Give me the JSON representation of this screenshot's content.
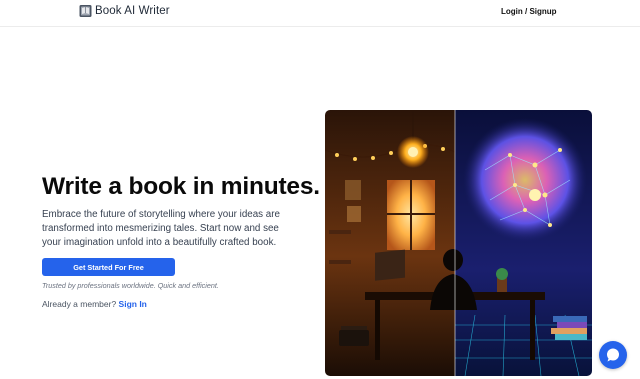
{
  "header": {
    "brand": "Book AI Writer",
    "login_label": "Login / Signup"
  },
  "hero": {
    "title": "Write a book in minutes.",
    "description": "Embrace the future of storytelling where your ideas are transformed into mesmerizing tales. Start now and see your imagination unfold into a beautifully crafted book.",
    "cta_label": "Get Started For Free",
    "trusted_text": "Trusted by professionals worldwide. Quick and efficient.",
    "member_prompt": "Already a member?",
    "signin_label": "Sign In"
  },
  "icons": {
    "logo": "book-logo-icon",
    "chat": "chat-bubble-icon"
  },
  "colors": {
    "accent": "#2563eb",
    "text": "#0a0a0a",
    "muted": "#6b7280"
  }
}
